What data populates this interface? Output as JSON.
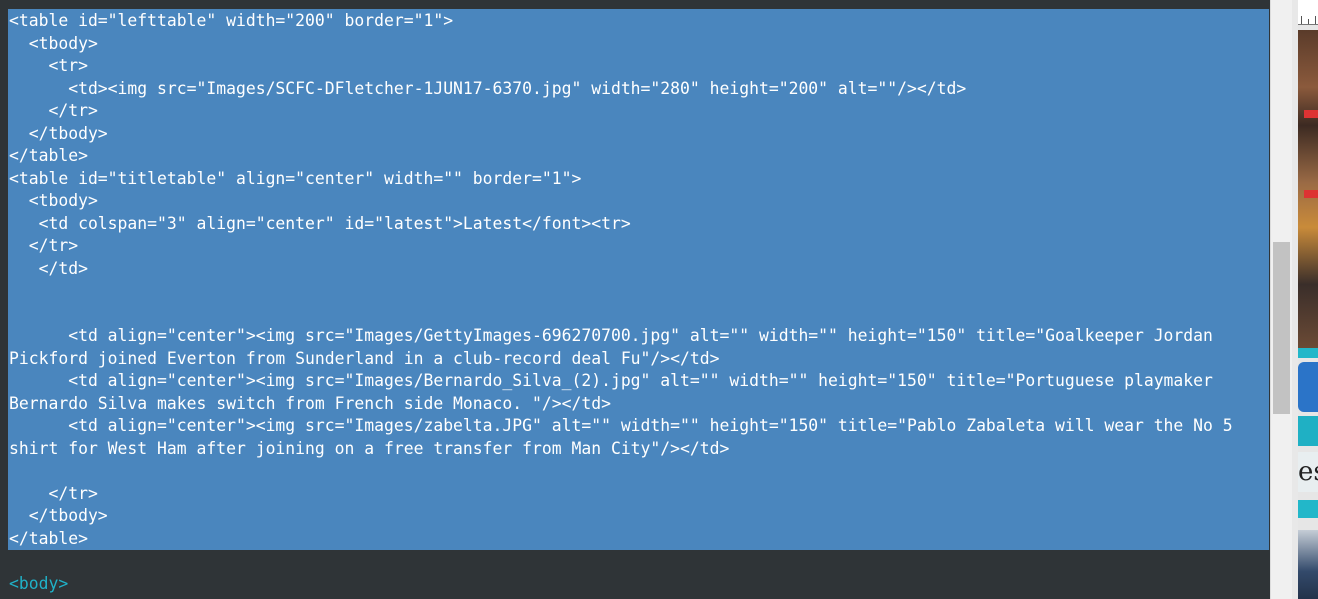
{
  "editor": {
    "selected_lines": [
      "<table id=\"lefttable\" width=\"200\" border=\"1\">",
      "  <tbody>",
      "    <tr>",
      "      <td><img src=\"Images/SCFC-DFletcher-1JUN17-6370.jpg\" width=\"280\" height=\"200\" alt=\"\"/></td>",
      "    </tr>",
      "  </tbody>",
      "</table>",
      "<table id=\"titletable\" align=\"center\" width=\"\" border=\"1\">",
      "  <tbody>",
      "   <td colspan=\"3\" align=\"center\" id=\"latest\">Latest</font><tr>",
      "  </tr>",
      "   </td>",
      "",
      "",
      "      <td align=\"center\"><img src=\"Images/GettyImages-696270700.jpg\" alt=\"\" width=\"\" height=\"150\" title=\"Goalkeeper Jordan",
      "Pickford joined Everton from Sunderland in a club-record deal Fu\"/></td>",
      "      <td align=\"center\"><img src=\"Images/Bernardo_Silva_(2).jpg\" alt=\"\" width=\"\" height=\"150\" title=\"Portuguese playmaker",
      "Bernardo Silva makes switch from French side Monaco. \"/></td>",
      "      <td align=\"center\"><img src=\"Images/zabelta.JPG\" alt=\"\" width=\"\" height=\"150\" title=\"Pablo Zabaleta will wear the No 5",
      "shirt for West Ham after joining on a free transfer from Man City\"/></td>",
      "",
      "    </tr>",
      "  </tbody>",
      "</table>"
    ],
    "next_line": "<body>"
  },
  "preview": {
    "partial_text": "esi"
  },
  "colors": {
    "editor_background": "#2f3437",
    "selection": "#4a86be",
    "selected_text": "#ffffff",
    "tag_text": "#20b2c8"
  }
}
